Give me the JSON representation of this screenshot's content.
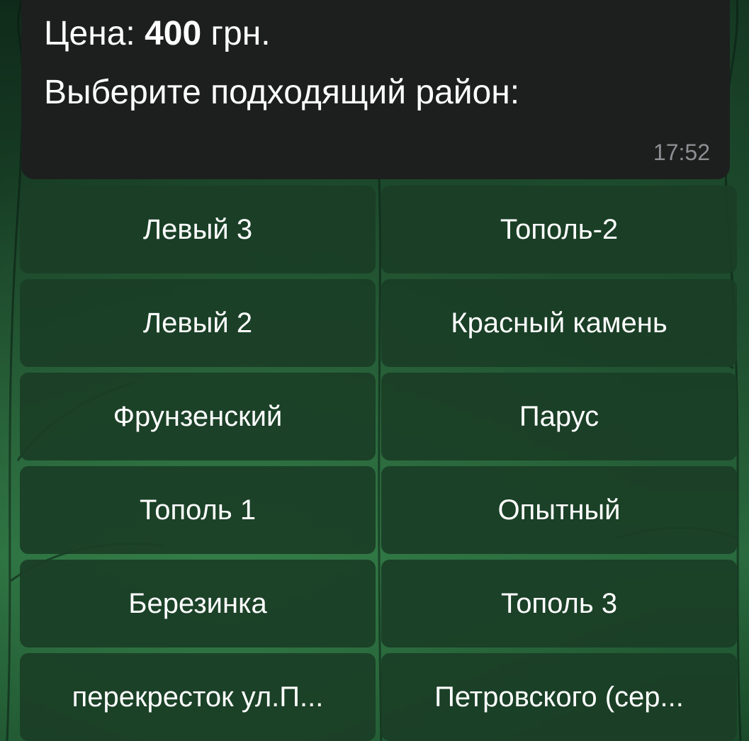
{
  "message": {
    "price_label": "Цена: ",
    "price_value": "400",
    "price_unit": " грн.",
    "prompt": "Выберите подходящий район:",
    "time": "17:52"
  },
  "keyboard": {
    "buttons": [
      "Левый 3",
      "Тополь-2",
      "Левый 2",
      "Красный камень",
      "Фрунзенский",
      "Парус",
      "Тополь 1",
      "Опытный",
      "Березинка",
      "Тополь 3",
      "перекресток ул.П...",
      "Петровского (сер..."
    ]
  },
  "colors": {
    "bubble": "#1d1f1e",
    "button": "#1a3e26",
    "text": "#ffffff",
    "time": "#8e8e93"
  }
}
